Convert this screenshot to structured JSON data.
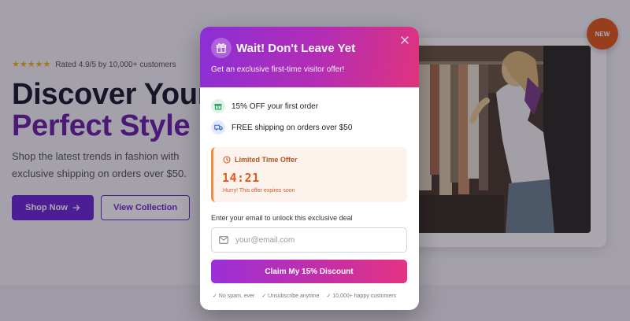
{
  "hero": {
    "stars": "★★★★★",
    "rating_text": "Rated 4.9/5 by 10,000+ customers",
    "headline_line1": "Discover Your",
    "headline_line2": "Perfect Style",
    "description": "Shop the latest trends in fashion with exclusive shipping on orders over $50.",
    "shop_now_label": "Shop Now",
    "shop_now_icon": "arrow-right-icon",
    "view_collection_label": "View Collection",
    "badge": "NEW"
  },
  "modal": {
    "icon": "gift-icon",
    "title": "Wait! Don't Leave Yet",
    "subtitle": "Get an exclusive first-time visitor offer!",
    "close_icon": "close-icon",
    "perks": [
      {
        "text": "15% OFF your first order",
        "icon": "gift-icon",
        "color": "#22a35a"
      },
      {
        "text": "FREE shipping on orders over $50",
        "icon": "truck-icon",
        "color": "#3b6fd8"
      }
    ],
    "timer": {
      "label": "Limited Time Offer",
      "icon": "clock-icon",
      "value": "14:21",
      "note": "Hurry! This offer expires soon"
    },
    "email_label": "Enter your email to unlock this exclusive deal",
    "email_placeholder": "your@email.com",
    "email_icon": "envelope-icon",
    "cta_label": "Claim My 15% Discount",
    "assurances": [
      "✓ No spam, ever",
      "✓ Unsubscribe anytime",
      "✓ 10,000+ happy customers"
    ]
  },
  "colors": {
    "brand_purple": "#6d28d9",
    "gradient_start": "#8b2fd6",
    "gradient_end": "#e0337e",
    "timer_accent": "#e0591d"
  }
}
